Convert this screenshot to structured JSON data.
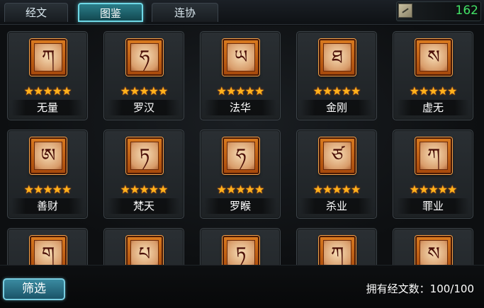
{
  "tabs": [
    {
      "label": "经文",
      "active": false
    },
    {
      "label": "图鉴",
      "active": true
    },
    {
      "label": "连协",
      "active": false
    }
  ],
  "currency": {
    "value": "162",
    "icon": "scroll-icon",
    "color": "#43e266"
  },
  "cards": [
    {
      "name": "无量",
      "glyph": "ཀ",
      "stars": "★★★★★"
    },
    {
      "name": "罗汉",
      "glyph": "ཧ",
      "stars": "★★★★★"
    },
    {
      "name": "法华",
      "glyph": "ཡ",
      "stars": "★★★★★"
    },
    {
      "name": "金刚",
      "glyph": "ཐ",
      "stars": "★★★★★"
    },
    {
      "name": "虚无",
      "glyph": "ས",
      "stars": "★★★★★"
    },
    {
      "name": "善财",
      "glyph": "ཨ",
      "stars": "★★★★★"
    },
    {
      "name": "梵天",
      "glyph": "ཏ",
      "stars": "★★★★★"
    },
    {
      "name": "罗睺",
      "glyph": "ཧ",
      "stars": "★★★★★"
    },
    {
      "name": "杀业",
      "glyph": "ཙ",
      "stars": "★★★★★"
    },
    {
      "name": "罪业",
      "glyph": "ཀ",
      "stars": "★★★★★"
    },
    {
      "name": "",
      "glyph": "ག",
      "stars": ""
    },
    {
      "name": "",
      "glyph": "པ",
      "stars": ""
    },
    {
      "name": "",
      "glyph": "ཏ",
      "stars": ""
    },
    {
      "name": "",
      "glyph": "ཀ",
      "stars": ""
    },
    {
      "name": "",
      "glyph": "ས",
      "stars": ""
    }
  ],
  "bottom": {
    "filter_label": "筛选",
    "owned_text": "拥有经文数：100/100"
  },
  "colors": {
    "star": "#ffb21c",
    "active_tab": "#2b7d89",
    "emblem": "#d97a1f"
  }
}
